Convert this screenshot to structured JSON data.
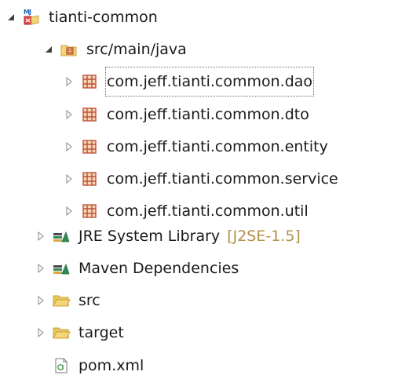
{
  "tree": {
    "project": {
      "label": "tianti-common",
      "icon": "maven-project-icon",
      "expanded": true
    },
    "source_folder": {
      "label": "src/main/java",
      "icon": "source-folder-icon",
      "expanded": true
    },
    "packages": [
      {
        "label": "com.jeff.tianti.common.dao",
        "icon": "package-icon",
        "selected": true
      },
      {
        "label": "com.jeff.tianti.common.dto",
        "icon": "package-icon"
      },
      {
        "label": "com.jeff.tianti.common.entity",
        "icon": "package-icon"
      },
      {
        "label": "com.jeff.tianti.common.service",
        "icon": "package-icon"
      },
      {
        "label": "com.jeff.tianti.common.util",
        "icon": "package-icon"
      }
    ],
    "jre_library": {
      "label": "JRE System Library",
      "decoration": "[J2SE-1.5]",
      "icon": "library-icon"
    },
    "maven_deps": {
      "label": "Maven Dependencies",
      "icon": "library-icon"
    },
    "folders": [
      {
        "label": "src",
        "icon": "folder-icon"
      },
      {
        "label": "target",
        "icon": "folder-icon"
      }
    ],
    "pom": {
      "label": "pom.xml",
      "icon": "xml-file-icon"
    }
  },
  "colors": {
    "package": "#c0503c",
    "folder_fill": "#f3d67a",
    "folder_stroke": "#c9a43a",
    "library_green": "#2e8b57",
    "decoration": "#b3914a"
  }
}
